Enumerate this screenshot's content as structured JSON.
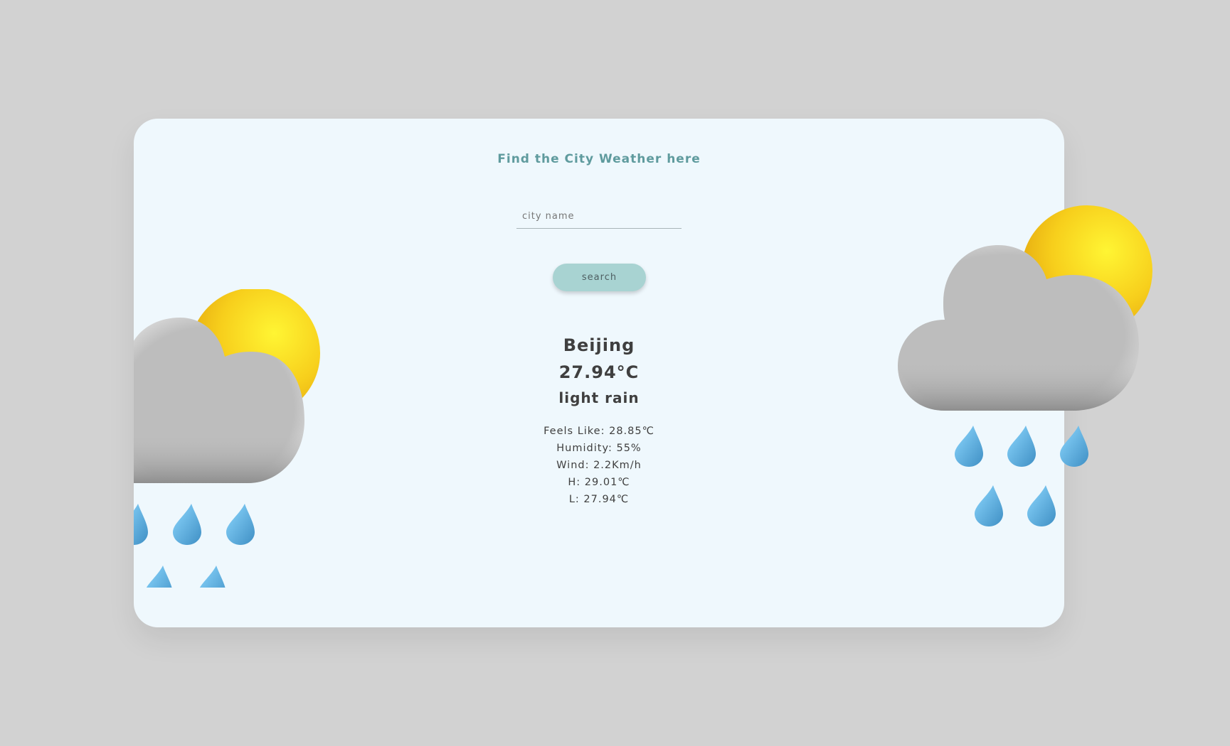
{
  "header": {
    "title": "Find the City Weather here"
  },
  "search": {
    "placeholder": "city name",
    "value": "",
    "button_label": "search"
  },
  "weather": {
    "city": "Beijing",
    "temperature": "27.94°C",
    "description": "light rain",
    "details": {
      "feels_like": "Feels Like: 28.85℃",
      "humidity": "Humidity: 55%",
      "wind": "Wind: 2.2Km/h",
      "high": "H: 29.01℃",
      "low": "L: 27.94℃"
    }
  },
  "icons": {
    "left_weather_icon": "sun-cloud-rain-icon",
    "right_weather_icon": "sun-cloud-rain-icon"
  },
  "colors": {
    "page_background": "#d2d2d2",
    "card_background": "#eff8fd",
    "title": "#5f9b9e",
    "button": "#a8d3d2",
    "text": "#3f3f3f",
    "sun": "#f2c21a",
    "cloud": "#bdbdbd",
    "raindrop": "#5fb0e0"
  }
}
